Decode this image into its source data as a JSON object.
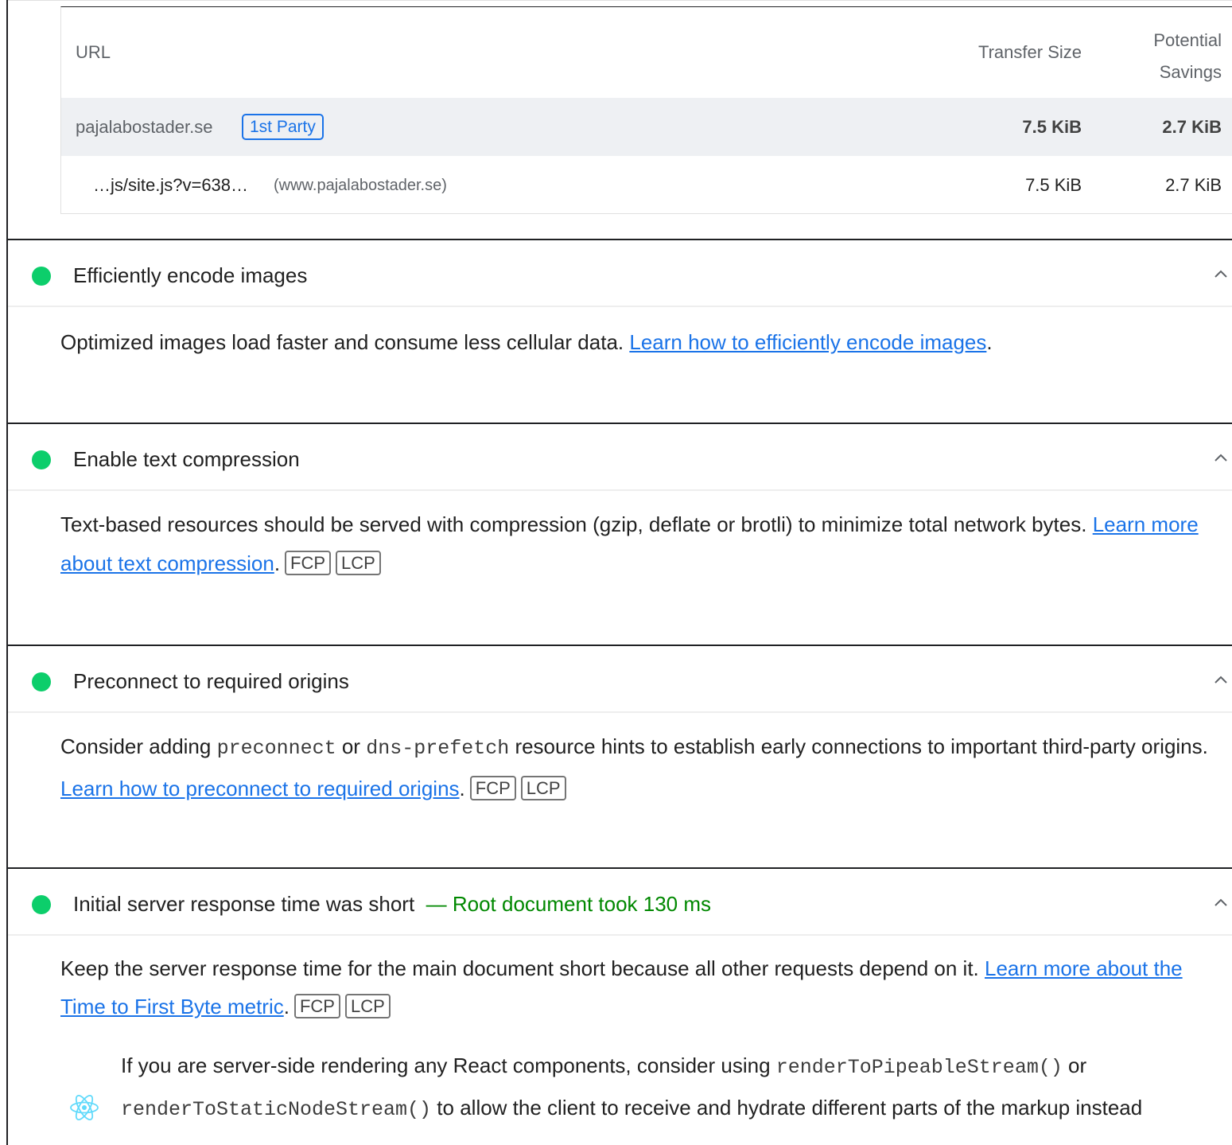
{
  "table": {
    "headers": {
      "url": "URL",
      "transfer_size": "Transfer Size",
      "potential_savings_line1": "Potential",
      "potential_savings_line2": "Savings"
    },
    "party_row": {
      "name": "pajalabostader.se",
      "badge": "1st Party",
      "transfer_size": "7.5 KiB",
      "potential_savings": "2.7 KiB"
    },
    "item_row": {
      "url": "…js/site.js?v=638…",
      "origin": "(www.pajalabostader.se)",
      "transfer_size": "7.5 KiB",
      "potential_savings": "2.7 KiB"
    }
  },
  "audits": [
    {
      "title": "Efficiently encode images",
      "description": "Optimized images load faster and consume less cellular data. ",
      "link": "Learn how to efficiently encode images",
      "after_link": "."
    },
    {
      "title": "Enable text compression",
      "description": "Text-based resources should be served with compression (gzip, deflate or brotli) to minimize total network bytes. ",
      "link": "Learn more about text compression",
      "after_link": ".",
      "tags": [
        "FCP",
        "LCP"
      ]
    },
    {
      "title": "Preconnect to required origins",
      "desc_part1": "Consider adding ",
      "code1": "preconnect",
      "desc_part2": " or ",
      "code2": "dns-prefetch",
      "desc_part3": " resource hints to establish early connections to important third-party origins. ",
      "link": "Learn how to preconnect to required origins",
      "after_link": ".",
      "tags": [
        "FCP",
        "LCP"
      ]
    },
    {
      "title": "Initial server response time was short",
      "subtitle": "— Root document took 130 ms",
      "description": "Keep the server response time for the main document short because all other requests depend on it. ",
      "link": "Learn more about the Time to First Byte metric",
      "after_link": ".",
      "tags": [
        "FCP",
        "LCP"
      ],
      "stack_hint": {
        "part1": "If you are server-side rendering any React components, consider using ",
        "code1": "renderToPipeableStream()",
        "part2": " or ",
        "code2": "renderToStaticNodeStream()",
        "part3": " to allow the client to receive and hydrate different parts of the markup instead"
      }
    }
  ],
  "colors": {
    "pass": "#0cce6b",
    "link": "#1a73e8",
    "subtitle": "#008800"
  },
  "icons": {
    "status": "pass-dot-icon",
    "toggle": "chevron-up-icon",
    "stack": "react-icon"
  }
}
